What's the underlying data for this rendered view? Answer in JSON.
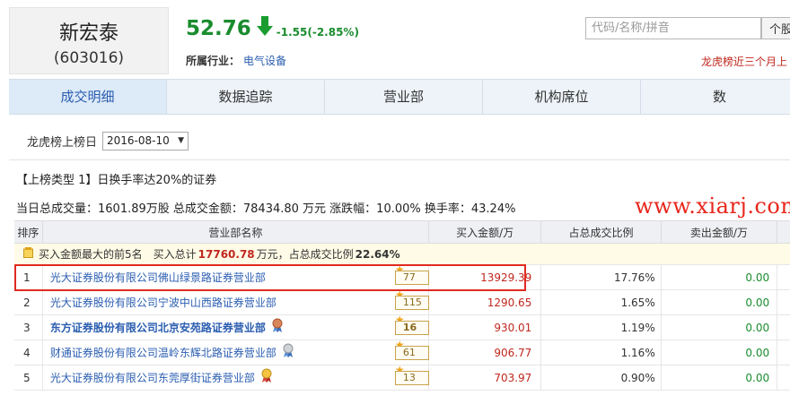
{
  "stock": {
    "name": "新宏泰",
    "code": "(603016)"
  },
  "quote": {
    "price": "52.76",
    "change": "-1.55(-2.85%)"
  },
  "industry": {
    "label": "所属行业：",
    "value": "电气设备"
  },
  "search": {
    "placeholder": "代码/名称/拼音",
    "button_label": "个股"
  },
  "notice": "龙虎榜近三个月上",
  "tabs": [
    {
      "label": "成交明细",
      "active": true
    },
    {
      "label": "数据追踪",
      "active": false
    },
    {
      "label": "营业部",
      "active": false
    },
    {
      "label": "机构席位",
      "active": false
    },
    {
      "label": "数",
      "active": false
    }
  ],
  "date_select": {
    "label": "龙虎榜上榜日",
    "value": "2016-08-10"
  },
  "list_type": "【上榜类型 1】日换手率达20%的证券",
  "summary": "当日总成交量：1601.89万股 总成交金额：78434.80 万元 涨跌幅：10.00% 换手率：43.24%",
  "watermark": "www.xiarj.com",
  "table": {
    "headers": [
      "排序",
      "营业部名称",
      "买入金额/万",
      "占总成交比例",
      "卖出金额/万"
    ],
    "group": {
      "prefix": "买入金额最大的前5名　买入总计",
      "total": "17760.78",
      "middle": "万元，占总成交比例",
      "ratio": "22.64%"
    },
    "rows": [
      {
        "rank": "1",
        "name": "光大证券股份有限公司佛山绿景路证券营业部",
        "bold": false,
        "count": "77",
        "medal": "",
        "buy": "13929.39",
        "ratio": "17.76%",
        "sell": "0.00"
      },
      {
        "rank": "2",
        "name": "光大证券股份有限公司宁波中山西路证券营业部",
        "bold": false,
        "count": "115",
        "medal": "",
        "buy": "1290.65",
        "ratio": "1.65%",
        "sell": "0.00"
      },
      {
        "rank": "3",
        "name": "东方证券股份有限公司北京安苑路证券营业部",
        "bold": true,
        "count": "16",
        "medal": "bronze",
        "buy": "930.01",
        "ratio": "1.19%",
        "sell": "0.00"
      },
      {
        "rank": "4",
        "name": "财通证券股份有限公司温岭东辉北路证券营业部",
        "bold": false,
        "count": "61",
        "medal": "silver",
        "buy": "906.77",
        "ratio": "1.16%",
        "sell": "0.00"
      },
      {
        "rank": "5",
        "name": "光大证券股份有限公司东莞厚街证券营业部",
        "bold": false,
        "count": "13",
        "medal": "gold",
        "buy": "703.97",
        "ratio": "0.90%",
        "sell": "0.00"
      }
    ]
  },
  "colors": {
    "up_red": "#c0281e",
    "down_green": "#1a8c2e",
    "link_blue": "#2a5db0"
  }
}
